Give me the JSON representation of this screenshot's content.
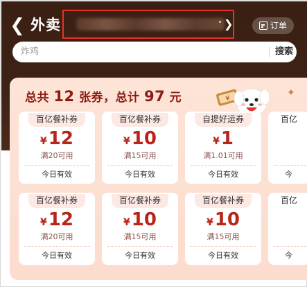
{
  "header": {
    "title": "外卖",
    "orders_label": "订单"
  },
  "search": {
    "placeholder": "炸鸡",
    "button_label": "搜索"
  },
  "summary": {
    "prefix": "总共",
    "count": "12",
    "middle": "张券，总计",
    "total": "97",
    "suffix": "元"
  },
  "coupons": [
    {
      "tag": "百亿餐补券",
      "currency": "¥",
      "value": "12",
      "condition": "满20可用",
      "validity": "今日有效"
    },
    {
      "tag": "百亿餐补券",
      "currency": "¥",
      "value": "10",
      "condition": "满15可用",
      "validity": "今日有效"
    },
    {
      "tag": "自提好运券",
      "currency": "¥",
      "value": "1",
      "condition": "满1.01可用",
      "validity": "今日有效"
    },
    {
      "tag": "百亿",
      "currency": "",
      "value": "",
      "condition": "",
      "validity": "今"
    },
    {
      "tag": "百亿餐补券",
      "currency": "¥",
      "value": "12",
      "condition": "满20可用",
      "validity": "今日有效"
    },
    {
      "tag": "百亿餐补券",
      "currency": "¥",
      "value": "10",
      "condition": "满15可用",
      "validity": "今日有效"
    },
    {
      "tag": "百亿餐补券",
      "currency": "¥",
      "value": "10",
      "condition": "满15可用",
      "validity": "今日有效"
    },
    {
      "tag": "百亿",
      "currency": "",
      "value": "",
      "condition": "",
      "validity": "今"
    }
  ],
  "colors": {
    "header_bg": "#3d2215",
    "panel_bg": "#fde4d7",
    "accent_red": "#b8251a",
    "highlight_border": "#e8312e"
  }
}
